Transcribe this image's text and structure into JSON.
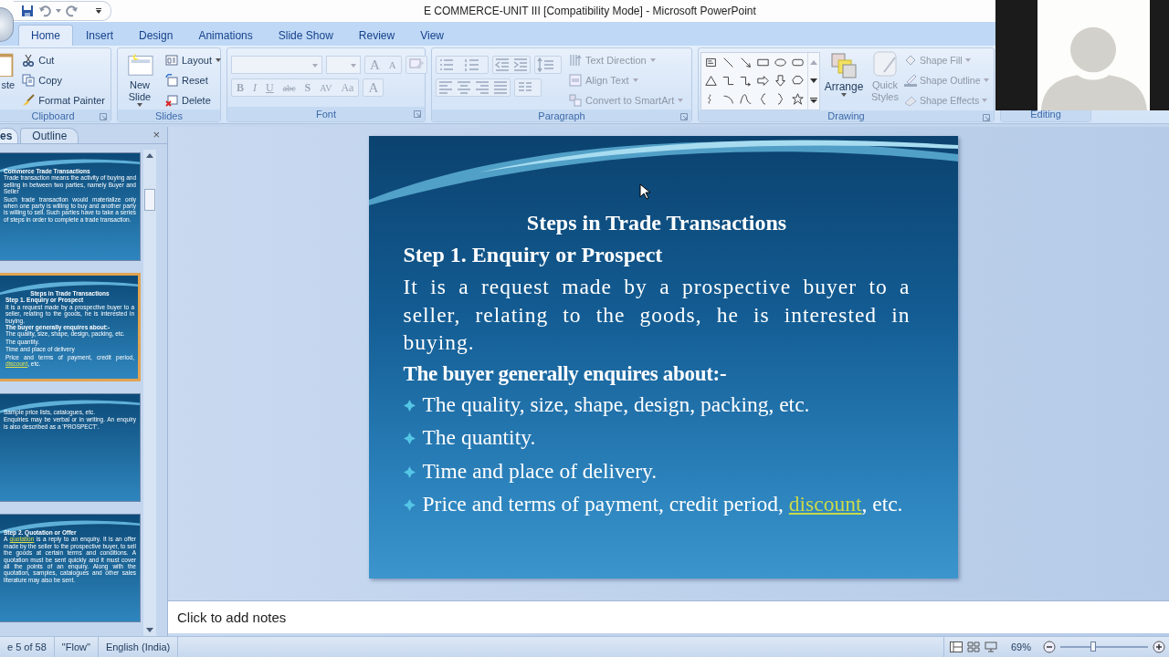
{
  "window": {
    "title": "E COMMERCE-UNIT III [Compatibility Mode] - Microsoft PowerPoint"
  },
  "tabs": [
    {
      "label": "Home",
      "selected": true
    },
    {
      "label": "Insert",
      "selected": false
    },
    {
      "label": "Design",
      "selected": false
    },
    {
      "label": "Animations",
      "selected": false
    },
    {
      "label": "Slide Show",
      "selected": false
    },
    {
      "label": "Review",
      "selected": false
    },
    {
      "label": "View",
      "selected": false
    }
  ],
  "ribbon": {
    "clipboard": {
      "label": "Clipboard",
      "paste": "ste",
      "items": [
        {
          "label": "Cut",
          "disabled": false
        },
        {
          "label": "Copy",
          "disabled": false
        },
        {
          "label": "Format Painter",
          "disabled": false
        }
      ]
    },
    "slides": {
      "label": "Slides",
      "new_slide": "New Slide",
      "items": [
        {
          "label": "Layout",
          "disabled": false
        },
        {
          "label": "Reset",
          "disabled": false
        },
        {
          "label": "Delete",
          "disabled": false
        }
      ]
    },
    "font": {
      "label": "Font",
      "size_buttons": [
        "A",
        "A"
      ],
      "style_buttons": [
        "B",
        "I",
        "U",
        "abc",
        "S",
        "AV",
        "Aa"
      ],
      "color_button": "A",
      "disabled": true
    },
    "paragraph": {
      "label": "Paragraph",
      "items": [
        {
          "label": "Text Direction",
          "disabled": true
        },
        {
          "label": "Align Text",
          "disabled": true
        },
        {
          "label": "Convert to SmartArt",
          "disabled": true
        }
      ]
    },
    "drawing": {
      "label": "Drawing",
      "arrange": {
        "label": "Arrange",
        "disabled": false
      },
      "quick_styles": {
        "label": "Quick Styles",
        "disabled": true
      },
      "items": [
        {
          "label": "Shape Fill",
          "disabled": true
        },
        {
          "label": "Shape Outline",
          "disabled": true
        },
        {
          "label": "Shape Effects",
          "disabled": true
        }
      ]
    },
    "editing": {
      "label": "Editing"
    }
  },
  "slide_pane": {
    "tabs": [
      {
        "label": "es",
        "selected": true
      },
      {
        "label": "Outline",
        "selected": false
      }
    ],
    "close": "×",
    "thumbnails": [
      {
        "selected": false,
        "lines": [
          {
            "kind": "heading",
            "text": "Commerce Trade Transactions"
          },
          {
            "kind": "bullet",
            "text": "Trade transaction means the activity of buying and selling in between two parties, namely Buyer and Seller"
          },
          {
            "kind": "bullet",
            "text": "Such trade transaction would materialize only when one party is willing to buy and another party is willing to sell. Such parties have to take a series of steps in order to complete a trade transaction."
          }
        ]
      },
      {
        "selected": true,
        "lines": [
          {
            "kind": "title",
            "text": "Steps in Trade Transactions"
          },
          {
            "kind": "heading",
            "text": "Step 1. Enquiry or Prospect"
          },
          {
            "kind": "text",
            "text": "It is a request made by a prospective buyer to a seller, relating to the goods, he is interested in buying."
          },
          {
            "kind": "heading",
            "text": "The buyer generally enquires about:-"
          },
          {
            "kind": "bullet",
            "text": "The quality, size, shape, design, packing, etc."
          },
          {
            "kind": "bullet",
            "text": "The quantity."
          },
          {
            "kind": "bullet",
            "text": "Time and place of delivery"
          },
          {
            "kind": "bullet",
            "text": "Price and terms of payment, credit period, ",
            "link": "discount",
            "after": ", etc."
          }
        ]
      },
      {
        "selected": false,
        "lines": [
          {
            "kind": "bullet",
            "text": "Sample price lists, catalogues, etc."
          },
          {
            "kind": "bullet",
            "text": "Enquiries may be verbal or in writing. An enquiry is also described as a 'PROSPECT'."
          }
        ]
      },
      {
        "selected": false,
        "lines": [
          {
            "kind": "heading",
            "text": "Step 2. Quotation or Offer"
          },
          {
            "kind": "text",
            "text": "A ",
            "link": "quotation",
            "after": " is a reply to an enquiry. It is an offer made by the seller to the prospective buyer, to sell the goods at certain terms and conditions. A quotation must be sent quickly and it must cover all the points of an enquiry. Along with the quotation, samples, catalogues and other sales literature may also be sent."
          }
        ]
      }
    ]
  },
  "slide": {
    "title": "Steps in Trade Transactions",
    "step": "Step 1. Enquiry or Prospect",
    "paragraph": "It is a request made by a prospective buyer to a seller, relating to the goods, he is interested in buying.",
    "subheading": "The buyer generally enquires about:-",
    "bullets": [
      {
        "text": "The quality, size, shape, design, packing, etc."
      },
      {
        "text": "The quantity."
      },
      {
        "text": "Time and place of delivery."
      },
      {
        "text": "Price and terms of payment, credit period, ",
        "link": "discount",
        "after": ", etc."
      }
    ]
  },
  "notes": {
    "placeholder": "Click to add notes"
  },
  "status_bar": {
    "slide_number": "e 5 of 58",
    "theme": "\"Flow\"",
    "language": "English (India)",
    "zoom": "69%",
    "zoom_slider": {
      "level": 0.38
    }
  }
}
